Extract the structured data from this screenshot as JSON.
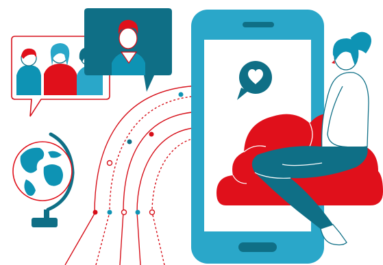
{
  "colors": {
    "teal": "#0e93b4",
    "teal_light": "#2aa7c9",
    "teal_dark": "#0f6f86",
    "red": "#e0101b",
    "red_dark": "#c40d17",
    "skin": "#ffffff",
    "screen": "#ffffff",
    "line": "#d60e18"
  },
  "icons": {
    "chat_heart": "heart-speech-bubble-icon",
    "globe": "globe-icon",
    "video_call_group": "group-video-call",
    "video_call_single": "single-video-call"
  }
}
